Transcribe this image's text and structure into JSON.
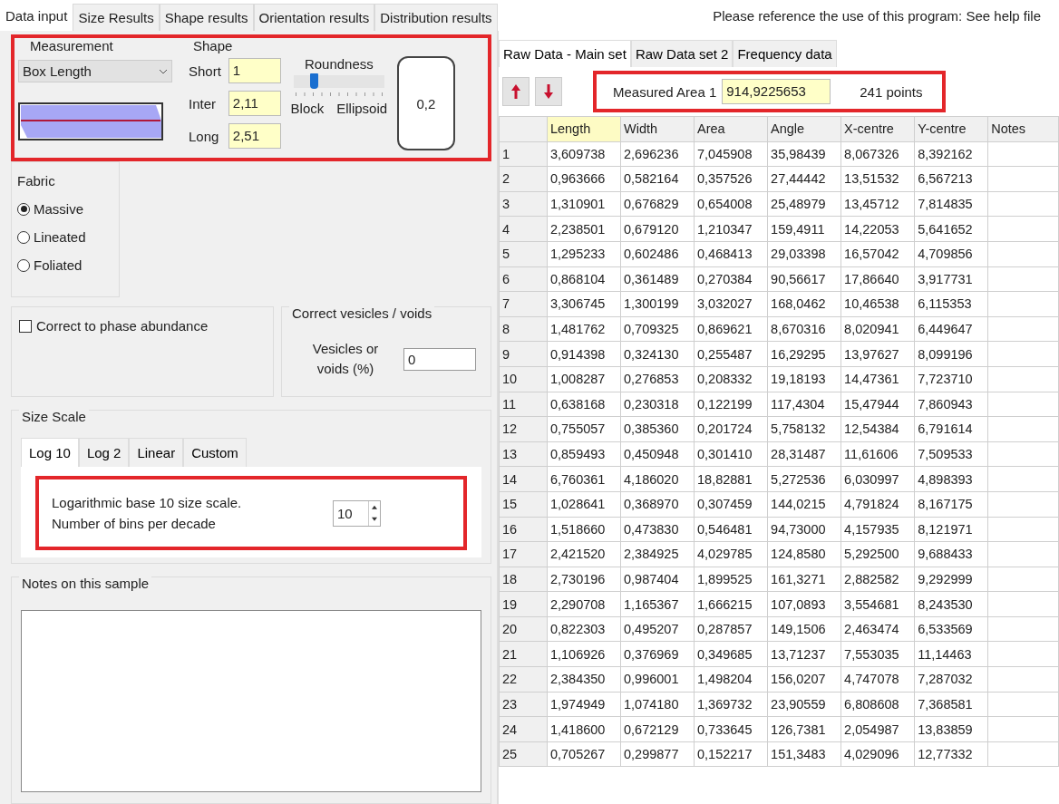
{
  "tabs": [
    {
      "label": "Data input",
      "selected": true
    },
    {
      "label": "Size Results",
      "selected": false
    },
    {
      "label": "Shape results",
      "selected": false
    },
    {
      "label": "Orientation results",
      "selected": false
    },
    {
      "label": "Distribution results",
      "selected": false
    }
  ],
  "help_text": "Please reference the use of this program: See help file",
  "measurement": {
    "title": "Measurement",
    "value": "Box Length"
  },
  "shape": {
    "title": "Shape",
    "fields": [
      {
        "label": "Short",
        "value": "1"
      },
      {
        "label": "Inter",
        "value": "2,11"
      },
      {
        "label": "Long",
        "value": "2,51"
      }
    ],
    "roundness": {
      "label": "Roundness",
      "level": 0.2,
      "left_label": "Block",
      "right_label": "Ellipsoid"
    },
    "value": "0,2"
  },
  "fabric": {
    "title": "Fabric",
    "options": [
      {
        "label": "Massive",
        "selected": true
      },
      {
        "label": "Lineated",
        "selected": false
      },
      {
        "label": "Foliated",
        "selected": false
      }
    ]
  },
  "phase": {
    "label": "Correct to phase abundance",
    "checked": false
  },
  "vesicles": {
    "title": "Correct vesicles / voids",
    "label": "Vesicles or voids (%)",
    "value": "0"
  },
  "size_scale": {
    "title": "Size Scale",
    "tabs": [
      {
        "label": "Log 10",
        "selected": true
      },
      {
        "label": "Log 2",
        "selected": false
      },
      {
        "label": "Linear",
        "selected": false
      },
      {
        "label": "Custom",
        "selected": false
      }
    ],
    "lines": [
      "Logarithmic base 10 size scale.",
      "Number of bins per decade"
    ],
    "bins": "10"
  },
  "notes": {
    "title": "Notes on this sample"
  },
  "data_tabs": [
    {
      "label": "Raw Data - Main set",
      "selected": true
    },
    {
      "label": "Raw Data set 2",
      "selected": false
    },
    {
      "label": "Frequency data",
      "selected": false
    }
  ],
  "measured_area": {
    "label": "Measured Area 1",
    "value": "914,9225653",
    "points": "241 points"
  },
  "table": {
    "columns": [
      {
        "selected": false
      },
      {
        "label": "Length",
        "selected": true
      },
      {
        "label": "Width",
        "selected": false
      },
      {
        "label": "Area",
        "selected": false
      },
      {
        "label": "Angle",
        "selected": false
      },
      {
        "label": "X-centre",
        "selected": false
      },
      {
        "label": "Y-centre",
        "selected": false
      },
      {
        "label": "Notes",
        "selected": false
      }
    ],
    "rows": [
      [
        "1",
        "3,609738",
        "2,696236",
        "7,045908",
        "35,98439",
        "8,067326",
        "8,392162"
      ],
      [
        "2",
        "0,963666",
        "0,582164",
        "0,357526",
        "27,44442",
        "13,51532",
        "6,567213"
      ],
      [
        "3",
        "1,310901",
        "0,676829",
        "0,654008",
        "25,48979",
        "13,45712",
        "7,814835"
      ],
      [
        "4",
        "2,238501",
        "0,679120",
        "1,210347",
        "159,4911",
        "14,22053",
        "5,641652"
      ],
      [
        "5",
        "1,295233",
        "0,602486",
        "0,468413",
        "29,03398",
        "16,57042",
        "4,709856"
      ],
      [
        "6",
        "0,868104",
        "0,361489",
        "0,270384",
        "90,56617",
        "17,86640",
        "3,917731"
      ],
      [
        "7",
        "3,306745",
        "1,300199",
        "3,032027",
        "168,0462",
        "10,46538",
        "6,115353"
      ],
      [
        "8",
        "1,481762",
        "0,709325",
        "0,869621",
        "8,670316",
        "8,020941",
        "6,449647"
      ],
      [
        "9",
        "0,914398",
        "0,324130",
        "0,255487",
        "16,29295",
        "13,97627",
        "8,099196"
      ],
      [
        "10",
        "1,008287",
        "0,276853",
        "0,208332",
        "19,18193",
        "14,47361",
        "7,723710"
      ],
      [
        "11",
        "0,638168",
        "0,230318",
        "0,122199",
        "117,4304",
        "15,47944",
        "7,860943"
      ],
      [
        "12",
        "0,755057",
        "0,385360",
        "0,201724",
        "5,758132",
        "12,54384",
        "6,791614"
      ],
      [
        "13",
        "0,859493",
        "0,450948",
        "0,301410",
        "28,31487",
        "11,61606",
        "7,509533"
      ],
      [
        "14",
        "6,760361",
        "4,186020",
        "18,82881",
        "5,272536",
        "6,030997",
        "4,898393"
      ],
      [
        "15",
        "1,028641",
        "0,368970",
        "0,307459",
        "144,0215",
        "4,791824",
        "8,167175"
      ],
      [
        "16",
        "1,518660",
        "0,473830",
        "0,546481",
        "94,73000",
        "4,157935",
        "8,121971"
      ],
      [
        "17",
        "2,421520",
        "2,384925",
        "4,029785",
        "124,8580",
        "5,292500",
        "9,688433"
      ],
      [
        "18",
        "2,730196",
        "0,987404",
        "1,899525",
        "161,3271",
        "2,882582",
        "9,292999"
      ],
      [
        "19",
        "2,290708",
        "1,165367",
        "1,666215",
        "107,0893",
        "3,554681",
        "8,243530"
      ],
      [
        "20",
        "0,822303",
        "0,495207",
        "0,287857",
        "149,1506",
        "2,463474",
        "6,533569"
      ],
      [
        "21",
        "1,106926",
        "0,376969",
        "0,349685",
        "13,71237",
        "7,553035",
        "11,14463"
      ],
      [
        "22",
        "2,384350",
        "0,996001",
        "1,498204",
        "156,0207",
        "4,747078",
        "7,287032"
      ],
      [
        "23",
        "1,974949",
        "1,074180",
        "1,369732",
        "23,90559",
        "6,808608",
        "7,368581"
      ],
      [
        "24",
        "1,418600",
        "0,672129",
        "0,733645",
        "126,7381",
        "2,054987",
        "13,83859"
      ],
      [
        "25",
        "0,705267",
        "0,299877",
        "0,152217",
        "151,3483",
        "4,029096",
        "12,77332"
      ]
    ]
  }
}
